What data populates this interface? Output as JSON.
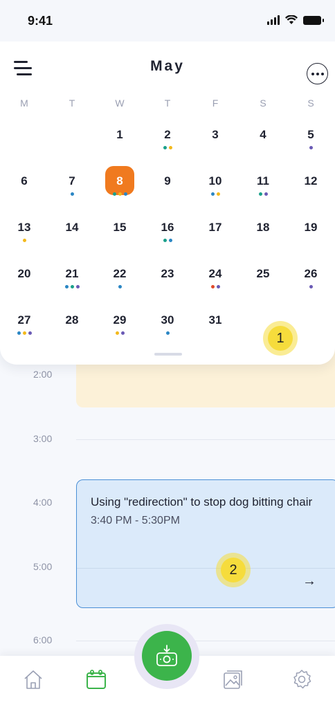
{
  "status_bar": {
    "time": "9:41"
  },
  "header": {
    "month": "May"
  },
  "weekdays": [
    "M",
    "T",
    "W",
    "T",
    "F",
    "S",
    "S"
  ],
  "days": [
    {
      "n": "1",
      "dots": []
    },
    {
      "n": "2",
      "dots": [
        "#1aa08a",
        "#f3b91c"
      ]
    },
    {
      "n": "3",
      "dots": []
    },
    {
      "n": "4",
      "dots": []
    },
    {
      "n": "5",
      "dots": [
        "#6a5ab5"
      ]
    },
    {
      "n": "6",
      "dots": []
    },
    {
      "n": "7",
      "dots": [
        "#2a86c4"
      ]
    },
    {
      "n": "8",
      "dots": [
        "#1aa08a",
        "#f3b91c",
        "#2a86c4"
      ],
      "selected": true
    },
    {
      "n": "9",
      "dots": []
    },
    {
      "n": "10",
      "dots": [
        "#2a86c4",
        "#f3b91c"
      ]
    },
    {
      "n": "11",
      "dots": [
        "#1aa08a",
        "#6a5ab5"
      ]
    },
    {
      "n": "12",
      "dots": []
    },
    {
      "n": "13",
      "dots": [
        "#f3b91c"
      ]
    },
    {
      "n": "14",
      "dots": []
    },
    {
      "n": "15",
      "dots": []
    },
    {
      "n": "16",
      "dots": [
        "#1aa08a",
        "#2a86c4"
      ]
    },
    {
      "n": "17",
      "dots": []
    },
    {
      "n": "18",
      "dots": []
    },
    {
      "n": "19",
      "dots": []
    },
    {
      "n": "20",
      "dots": []
    },
    {
      "n": "21",
      "dots": [
        "#2a86c4",
        "#1aa08a",
        "#6a5ab5"
      ]
    },
    {
      "n": "22",
      "dots": [
        "#2a86c4"
      ]
    },
    {
      "n": "23",
      "dots": []
    },
    {
      "n": "24",
      "dots": [
        "#e04a2a",
        "#6a5ab5"
      ]
    },
    {
      "n": "25",
      "dots": []
    },
    {
      "n": "26",
      "dots": [
        "#6a5ab5"
      ]
    },
    {
      "n": "27",
      "dots": [
        "#2a86c4",
        "#f3b91c",
        "#6a5ab5"
      ]
    },
    {
      "n": "28",
      "dots": []
    },
    {
      "n": "29",
      "dots": [
        "#f3b91c",
        "#6a5ab5"
      ]
    },
    {
      "n": "30",
      "dots": [
        "#2a86c4"
      ]
    },
    {
      "n": "31",
      "dots": []
    }
  ],
  "timeline": {
    "hours": [
      "2:00",
      "3:00",
      "4:00",
      "5:00",
      "6:00"
    ]
  },
  "event": {
    "title": "Using \"redirection\" to stop dog bitting chair",
    "time": "3:40 PM - 5:30PM",
    "arrow": "→"
  },
  "markers": [
    "1",
    "2"
  ],
  "nav": {
    "items": [
      "home-icon",
      "calendar-icon",
      "camera-upload-icon",
      "gallery-icon",
      "settings-icon"
    ],
    "active": "calendar-icon",
    "fab_color": "#3cb44b",
    "active_color": "#3cb44b"
  }
}
